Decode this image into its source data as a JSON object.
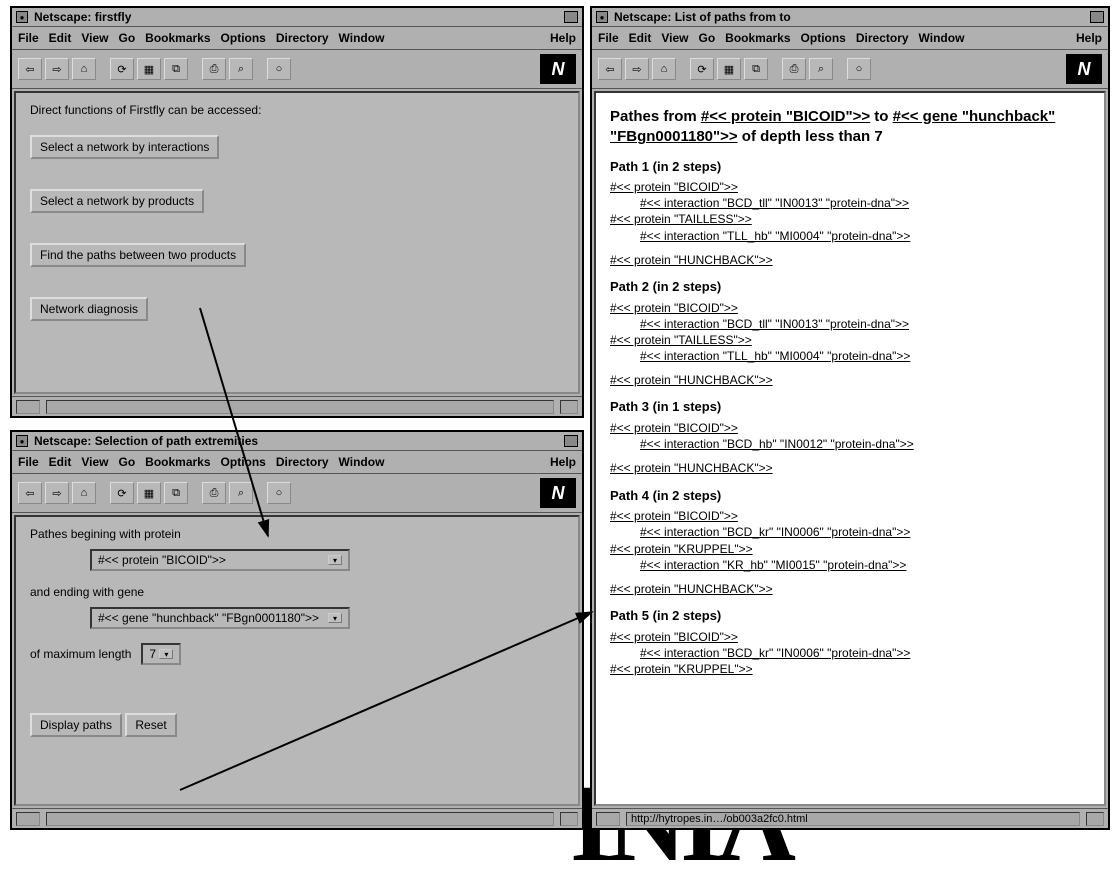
{
  "menus": {
    "file": "File",
    "edit": "Edit",
    "view": "View",
    "go": "Go",
    "bookmarks": "Bookmarks",
    "options": "Options",
    "directory": "Directory",
    "window": "Window",
    "help": "Help"
  },
  "win1": {
    "title": "Netscape: firstfly",
    "intro": "Direct functions of Firstfly can be accessed:",
    "btn1": "Select a network by interactions",
    "btn2": "Select a network by products",
    "btn3": "Find the paths between two products",
    "btn4": "Network diagnosis"
  },
  "win2": {
    "title": "Netscape: Selection of path extremities",
    "label1": "Pathes begining with protein",
    "select1": "#<< protein \"BICOID\">>",
    "label2": "and ending with gene",
    "select2": "#<< gene \"hunchback\" \"FBgn0001180\">>",
    "label3": "of maximum length",
    "select3": "7",
    "btnDisplay": "Display paths",
    "btnReset": "Reset"
  },
  "win3": {
    "title": "Netscape: List of paths from to",
    "status": "http://hytropes.in…/ob003a2fc0.html",
    "heading_pre": "Pathes from ",
    "heading_link1": "#<< protein \"BICOID\">>",
    "heading_mid": " to ",
    "heading_link2": "#<< gene \"hunchback\" \"FBgn0001180\">>",
    "heading_post": " of depth less than 7",
    "paths": [
      {
        "title": "Path 1 (in 2 steps)",
        "lines": [
          {
            "t": "#<< protein \"BICOID\">>",
            "i": 0
          },
          {
            "t": "#<< interaction \"BCD_tll\" \"IN0013\" \"protein-dna\">>",
            "i": 1
          },
          {
            "t": "#<< protein \"TAILLESS\">>",
            "i": 0
          },
          {
            "t": "#<< interaction \"TLL_hb\" \"MI0004\" \"protein-dna\">>",
            "i": 1
          }
        ],
        "end": "#<< protein \"HUNCHBACK\">>"
      },
      {
        "title": "Path 2 (in 2 steps)",
        "lines": [
          {
            "t": "#<< protein \"BICOID\">>",
            "i": 0
          },
          {
            "t": "#<< interaction \"BCD_tll\" \"IN0013\" \"protein-dna\">>",
            "i": 1
          },
          {
            "t": "#<< protein \"TAILLESS\">>",
            "i": 0
          },
          {
            "t": "#<< interaction \"TLL_hb\" \"MI0004\" \"protein-dna\">>",
            "i": 1
          }
        ],
        "end": "#<< protein \"HUNCHBACK\">>"
      },
      {
        "title": "Path 3 (in 1 steps)",
        "lines": [
          {
            "t": "#<< protein \"BICOID\">>",
            "i": 0
          },
          {
            "t": "#<< interaction \"BCD_hb\" \"IN0012\" \"protein-dna\">>",
            "i": 1
          }
        ],
        "end": "#<< protein \"HUNCHBACK\">>"
      },
      {
        "title": "Path 4 (in 2 steps)",
        "lines": [
          {
            "t": "#<< protein \"BICOID\">>",
            "i": 0
          },
          {
            "t": "#<< interaction \"BCD_kr\" \"IN0006\" \"protein-dna\">>",
            "i": 1
          },
          {
            "t": "#<< protein \"KRUPPEL\">>",
            "i": 0
          },
          {
            "t": "#<< interaction \"KR_hb\" \"MI0015\" \"protein-dna\">>",
            "i": 1
          }
        ],
        "end": "#<< protein \"HUNCHBACK\">>"
      },
      {
        "title": "Path 5 (in 2 steps)",
        "lines": [
          {
            "t": "#<< protein \"BICOID\">>",
            "i": 0
          },
          {
            "t": "#<< interaction \"BCD_kr\" \"IN0006\" \"protein-dna\">>",
            "i": 1
          },
          {
            "t": "#<< protein \"KRUPPEL\">>",
            "i": 0
          }
        ],
        "end": ""
      }
    ]
  }
}
